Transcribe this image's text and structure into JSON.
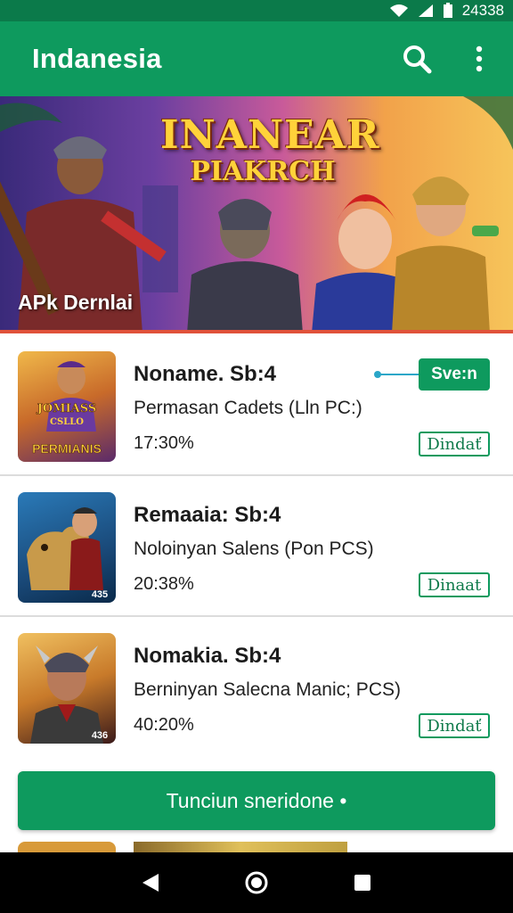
{
  "status_bar": {
    "time": "24338"
  },
  "app_bar": {
    "title": "Indanesia",
    "search_icon": "search-icon",
    "menu_icon": "more-vert-icon"
  },
  "banner": {
    "title_line1": "INANEAR",
    "title_line2": "PIAKRCH",
    "caption": "APk Dernlai"
  },
  "apps": [
    {
      "name": "Noname. Sb:4",
      "desc": "Permasan Cadets (Lln PC:)",
      "pct": "17:30%",
      "thumb_text_1": "JOMIASS",
      "thumb_text_2": "CSLLO",
      "thumb_text_3": "PERMIANIS",
      "button": "Dindať",
      "action_button": "Sve:n"
    },
    {
      "name": "Remaaia: Sb:4",
      "desc": "Noloinyan Salens (Pon PCS)",
      "pct": "20:38%",
      "thumb_badge": "435",
      "button": "Dinaat"
    },
    {
      "name": "Nomakia. Sb:4",
      "desc": "Berninyan Salecna Manic; PCS)",
      "pct": "40:20%",
      "thumb_badge": "436",
      "button": "Dindať"
    }
  ],
  "cta": {
    "label": "Tunciun sneridone •"
  },
  "nav": {
    "back_icon": "back-icon",
    "home_icon": "home-icon",
    "recents_icon": "recents-icon"
  },
  "colors": {
    "primary": "#0e9a5e",
    "status": "#0b7a4a",
    "accent_line": "#2aa6c8"
  }
}
